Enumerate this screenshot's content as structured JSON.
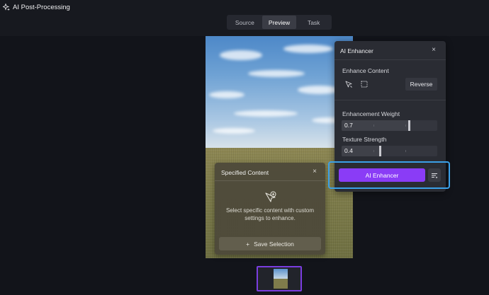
{
  "app": {
    "title": "AI Post-Processing"
  },
  "tabs": [
    {
      "label": "Source",
      "active": false
    },
    {
      "label": "Preview",
      "active": true
    },
    {
      "label": "Task",
      "active": false
    }
  ],
  "specified_content": {
    "title": "Specified Content",
    "close": "×",
    "description": "Select specific content with custom settings to enhance.",
    "save_label": "Save Selection",
    "save_icon": "+"
  },
  "enhancer": {
    "title": "AI Enhancer",
    "close": "×",
    "enhance_content_label": "Enhance Content",
    "reverse_label": "Reverse",
    "weight_label": "Enhancement Weight",
    "weight_value": "0.7",
    "weight_fraction": 0.7,
    "texture_label": "Texture Strength",
    "texture_value": "0.4",
    "texture_fraction": 0.4,
    "action_label": "AI Enhancer"
  },
  "icons": {
    "app": "sparkle-icon",
    "select": "cursor-select-icon",
    "marquee": "marquee-select-icon",
    "menu": "list-menu-icon",
    "spec": "select-plus-icon"
  },
  "colors": {
    "accent": "#8a3cf6",
    "highlight": "#3ba0e8",
    "thumbnail_border": "#7a3de0"
  }
}
